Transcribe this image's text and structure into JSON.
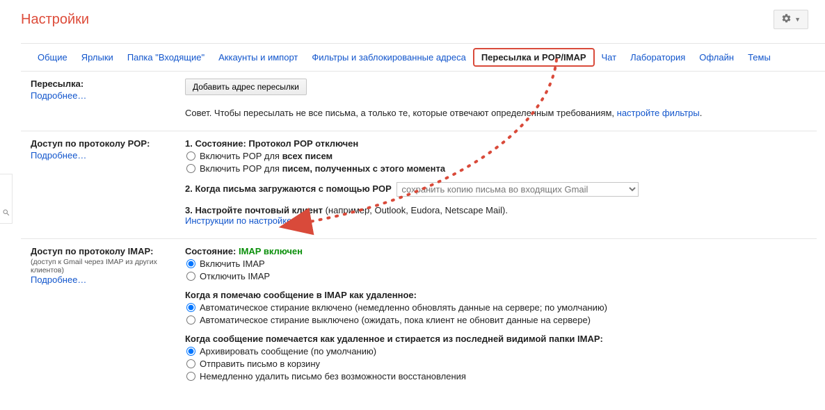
{
  "header": {
    "title": "Настройки"
  },
  "tabs": {
    "general": "Общие",
    "labels": "Ярлыки",
    "inbox": "Папка \"Входящие\"",
    "accounts": "Аккаунты и импорт",
    "filters": "Фильтры и заблокированные адреса",
    "forwarding": "Пересылка и POP/IMAP",
    "chat": "Чат",
    "labs": "Лаборатория",
    "offline": "Офлайн",
    "themes": "Темы"
  },
  "forwarding": {
    "title": "Пересылка:",
    "learn_more": "Подробнее…",
    "add_button": "Добавить адрес пересылки",
    "tip_prefix": "Совет. Чтобы пересылать не все письма, а только те, которые отвечают определенным требованиям, ",
    "tip_link": "настройте фильтры",
    "tip_suffix": "."
  },
  "pop": {
    "title": "Доступ по протоколу POP:",
    "learn_more": "Подробнее…",
    "status_label": "1. Состояние: Протокол POP отключен",
    "radio_all_prefix": "Включить POP для ",
    "radio_all_bold": "всех писем",
    "radio_now_prefix": "Включить POP для ",
    "radio_now_bold": "писем, полученных с этого момента",
    "when_download_label": "2. Когда письма загружаются с помощью POP",
    "select_value": "сохранить копию письма во входящих Gmail",
    "configure_label": "3. Настройте почтовый клиент",
    "configure_hint": " (например, Outlook, Eudora, Netscape Mail).",
    "instructions_link": "Инструкции по настройке"
  },
  "imap": {
    "title": "Доступ по протоколу IMAP:",
    "subtitle": "(доступ к Gmail через IMAP из других клиентов)",
    "learn_more": "Подробнее…",
    "status_prefix": "Состояние: ",
    "status_value": "IMAP включен",
    "radio_enable": "Включить IMAP",
    "radio_disable": "Отключить IMAP",
    "deleted_heading": "Когда я помечаю сообщение в IMAP как удаленное:",
    "deleted_auto_on": "Автоматическое стирание включено (немедленно обновлять данные на сервере; по умолчанию)",
    "deleted_auto_off": "Автоматическое стирание выключено (ожидать, пока клиент не обновит данные на сервере)",
    "last_folder_heading": "Когда сообщение помечается как удаленное и стирается из последней видимой папки IMAP:",
    "last_archive": "Архивировать сообщение (по умолчанию)",
    "last_trash": "Отправить письмо в корзину",
    "last_delete": "Немедленно удалить письмо без возможности восстановления"
  }
}
